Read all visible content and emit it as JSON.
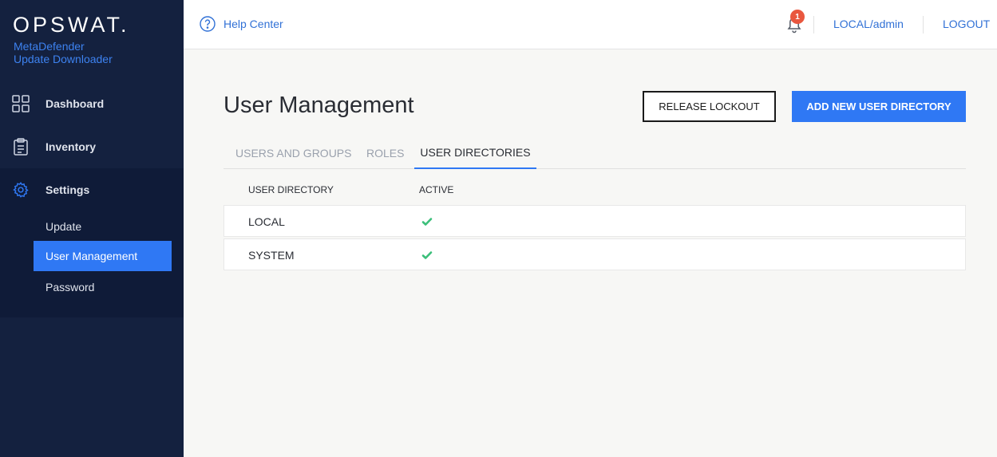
{
  "brand": {
    "logo": "OPSWAT.",
    "product_line1": "MetaDefender",
    "product_line2": "Update Downloader"
  },
  "sidebar": {
    "items": [
      {
        "label": "Dashboard",
        "icon": "dashboard-grid-icon"
      },
      {
        "label": "Inventory",
        "icon": "clipboard-icon"
      },
      {
        "label": "Settings",
        "icon": "gear-icon"
      }
    ],
    "settings_sub": [
      {
        "label": "Update"
      },
      {
        "label": "User Management",
        "active": true
      },
      {
        "label": "Password"
      }
    ]
  },
  "header": {
    "help_label": "Help Center",
    "notification_count": "1",
    "user_label": "LOCAL/admin",
    "logout_label": "LOGOUT"
  },
  "main": {
    "title": "User Management",
    "release_lockout_label": "RELEASE LOCKOUT",
    "add_directory_label": "ADD NEW USER DIRECTORY",
    "tabs": [
      {
        "label": "USERS AND GROUPS"
      },
      {
        "label": "ROLES"
      },
      {
        "label": "USER DIRECTORIES",
        "active": true
      }
    ],
    "table": {
      "columns": [
        "USER DIRECTORY",
        "ACTIVE"
      ],
      "rows": [
        {
          "name": "LOCAL",
          "active": true
        },
        {
          "name": "SYSTEM",
          "active": true
        }
      ]
    }
  },
  "colors": {
    "sidebar_bg": "#14213f",
    "accent_blue": "#2f78f4",
    "check_green": "#3bbf7a",
    "badge_red": "#e9573f"
  }
}
